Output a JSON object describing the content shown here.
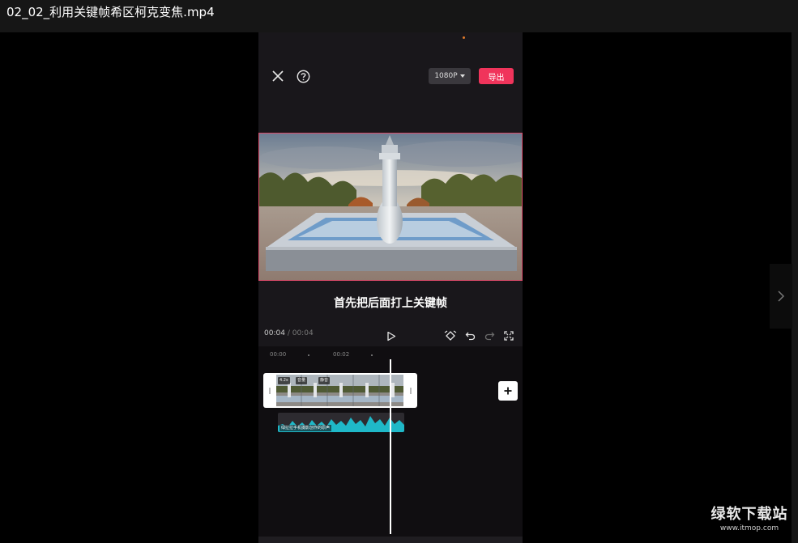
{
  "window": {
    "title": "02_02_利用关键帧希区柯克变焦.mp4"
  },
  "editor": {
    "close_icon": "close-icon",
    "help_icon": "help-icon",
    "resolution_label": "1080P",
    "export_label": "导出"
  },
  "subtitle": "首先把后面打上关键帧",
  "playback": {
    "current": "00:04",
    "separator": "/",
    "total": "00:04",
    "icons": [
      "play-icon",
      "keyframe-icon",
      "undo-icon",
      "redo-icon",
      "fullscreen-icon"
    ]
  },
  "timeline": {
    "ruler": [
      "00:00",
      "00:02"
    ],
    "clip_chips": [
      "4.2s",
      "音量",
      "静音"
    ],
    "audio_label": "绿拉拉手机摄影创作的原声",
    "add_icon": "plus-icon"
  },
  "watermark": {
    "name": "绿软下载站",
    "url": "www.itmop.com"
  },
  "colors": {
    "accent": "#f0345b",
    "waveform": "#1fb8c8",
    "preview_border": "#d94b6a"
  }
}
